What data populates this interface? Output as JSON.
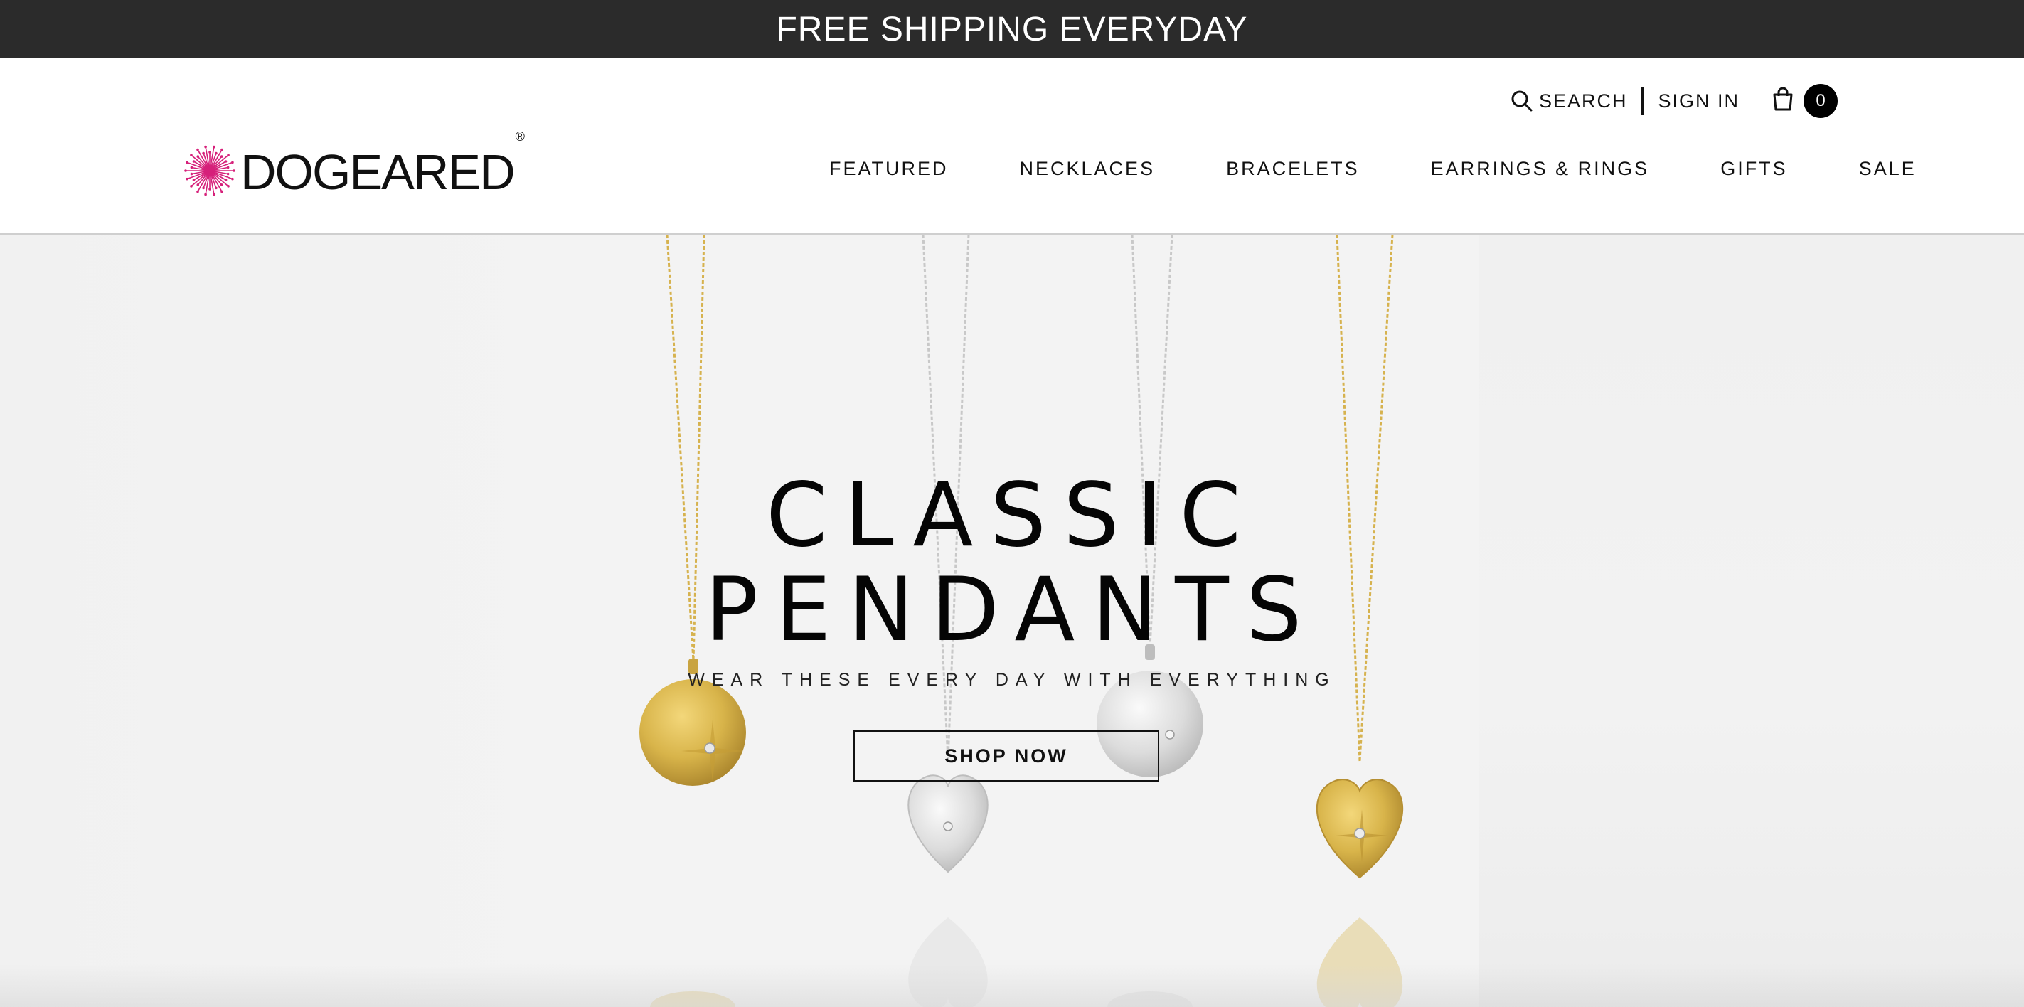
{
  "promo": {
    "text": "FREE SHIPPING EVERYDAY"
  },
  "header": {
    "search_label": "SEARCH",
    "sign_in_label": "SIGN IN",
    "cart_count": "0",
    "logo_text": "DOGEARED",
    "logo_reg": "®"
  },
  "nav": {
    "items": [
      {
        "label": "FEATURED"
      },
      {
        "label": "NECKLACES"
      },
      {
        "label": "BRACELETS"
      },
      {
        "label": "EARRINGS & RINGS"
      },
      {
        "label": "GIFTS"
      },
      {
        "label": "SALE"
      }
    ]
  },
  "hero": {
    "title_line1": "CLASSIC",
    "title_line2": "PENDANTS",
    "subtitle": "WEAR THESE EVERY DAY WITH EVERYTHING",
    "cta_label": "SHOP NOW"
  },
  "colors": {
    "promo_bg": "#2b2b2b",
    "logo_accent": "#d6207a",
    "gold": "#d8b44a",
    "silver": "#d9d9d9"
  }
}
